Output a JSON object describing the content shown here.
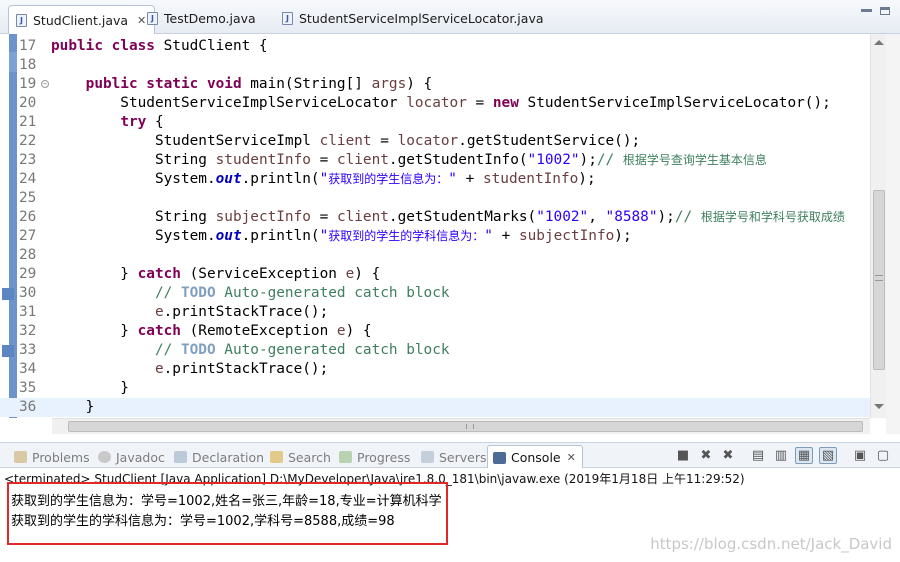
{
  "editor_tabs": [
    {
      "label": "StudClient.java",
      "close": "✕"
    },
    {
      "label": "TestDemo.java"
    },
    {
      "label": "StudentServiceImplServiceLocator.java"
    }
  ],
  "code_lines": [
    {
      "num": "17",
      "html": "<span class=\"kw\">public class</span> StudClient {"
    },
    {
      "num": "18",
      "html": ""
    },
    {
      "num": "19",
      "html": "    <span class=\"kw\">public static void</span> main(String[] <span class=\"var\">args</span>) {"
    },
    {
      "num": "20",
      "html": "        StudentServiceImplServiceLocator <span class=\"var\">locator</span> = <span class=\"kw\">new</span> StudentServiceImplServiceLocator();"
    },
    {
      "num": "21",
      "html": "        <span class=\"kw\">try</span> {"
    },
    {
      "num": "22",
      "html": "            StudentServiceImpl <span class=\"var\">client</span> = <span class=\"var\">locator</span>.getStudentService();"
    },
    {
      "num": "23",
      "html": "            String <span class=\"var\">studentInfo</span> = <span class=\"var\">client</span>.getStudentInfo(<span class=\"str\">\"1002\"</span>);<span class=\"cmt\">// <span class=\"cjk\">根据学号查询学生基本信息</span></span>"
    },
    {
      "num": "24",
      "html": "            System.<span class=\"fld\">out</span>.println(<span class=\"str\">\"<span class=\"cjk\">获取到的学生信息为：</span>\"</span> + <span class=\"var\">studentInfo</span>);"
    },
    {
      "num": "25",
      "html": ""
    },
    {
      "num": "26",
      "html": "            String <span class=\"var\">subjectInfo</span> = <span class=\"var\">client</span>.getStudentMarks(<span class=\"str\">\"1002\"</span>, <span class=\"str\">\"8588\"</span>);<span class=\"cmt\">// <span class=\"cjk\">根据学号和学科号获取成绩</span></span>"
    },
    {
      "num": "27",
      "html": "            System.<span class=\"fld\">out</span>.println(<span class=\"str\">\"<span class=\"cjk\">获取到的学生的学科信息为：</span>\"</span> + <span class=\"var\">subjectInfo</span>);"
    },
    {
      "num": "28",
      "html": ""
    },
    {
      "num": "29",
      "html": "        } <span class=\"kw\">catch</span> (ServiceException <span class=\"var\">e</span>) {"
    },
    {
      "num": "30",
      "html": "            <span class=\"cmt\">// <span class=\"todo\">TODO</span> Auto-generated catch block</span>"
    },
    {
      "num": "31",
      "html": "            <span class=\"var\">e</span>.printStackTrace();"
    },
    {
      "num": "32",
      "html": "        } <span class=\"kw\">catch</span> (RemoteException <span class=\"var\">e</span>) {"
    },
    {
      "num": "33",
      "html": "            <span class=\"cmt\">// <span class=\"todo\">TODO</span> Auto-generated catch block</span>"
    },
    {
      "num": "34",
      "html": "            <span class=\"var\">e</span>.printStackTrace();"
    },
    {
      "num": "35",
      "html": "        }"
    },
    {
      "num": "36",
      "html": "    }"
    }
  ],
  "view_tabs": [
    {
      "label": "Problems",
      "icon": "problems-icon"
    },
    {
      "label": "Javadoc",
      "icon": "javadoc-icon"
    },
    {
      "label": "Declaration",
      "icon": "declaration-icon"
    },
    {
      "label": "Search",
      "icon": "search-icon"
    },
    {
      "label": "Progress",
      "icon": "progress-icon"
    },
    {
      "label": "Servers",
      "icon": "servers-icon"
    },
    {
      "label": "Console",
      "icon": "console-icon",
      "close": "✕"
    }
  ],
  "console": {
    "terminated_line": "<terminated> StudClient [Java Application] D:\\MyDeveloper\\Java\\jre1.8.0_181\\bin\\javaw.exe (2019年1月18日 上午11:29:52)",
    "output": [
      "获取到的学生信息为：学号=1002,姓名=张三,年龄=18,专业=计算机科学",
      "获取到的学生的学科信息为：学号=1002,学科号=8588,成绩=98"
    ]
  },
  "watermark": "https://blog.csdn.net/Jack_David",
  "colors": {
    "highlight_box": "#e0292b",
    "keyword": "#7f0055",
    "string": "#2a00ff",
    "comment": "#3f7f5f"
  }
}
